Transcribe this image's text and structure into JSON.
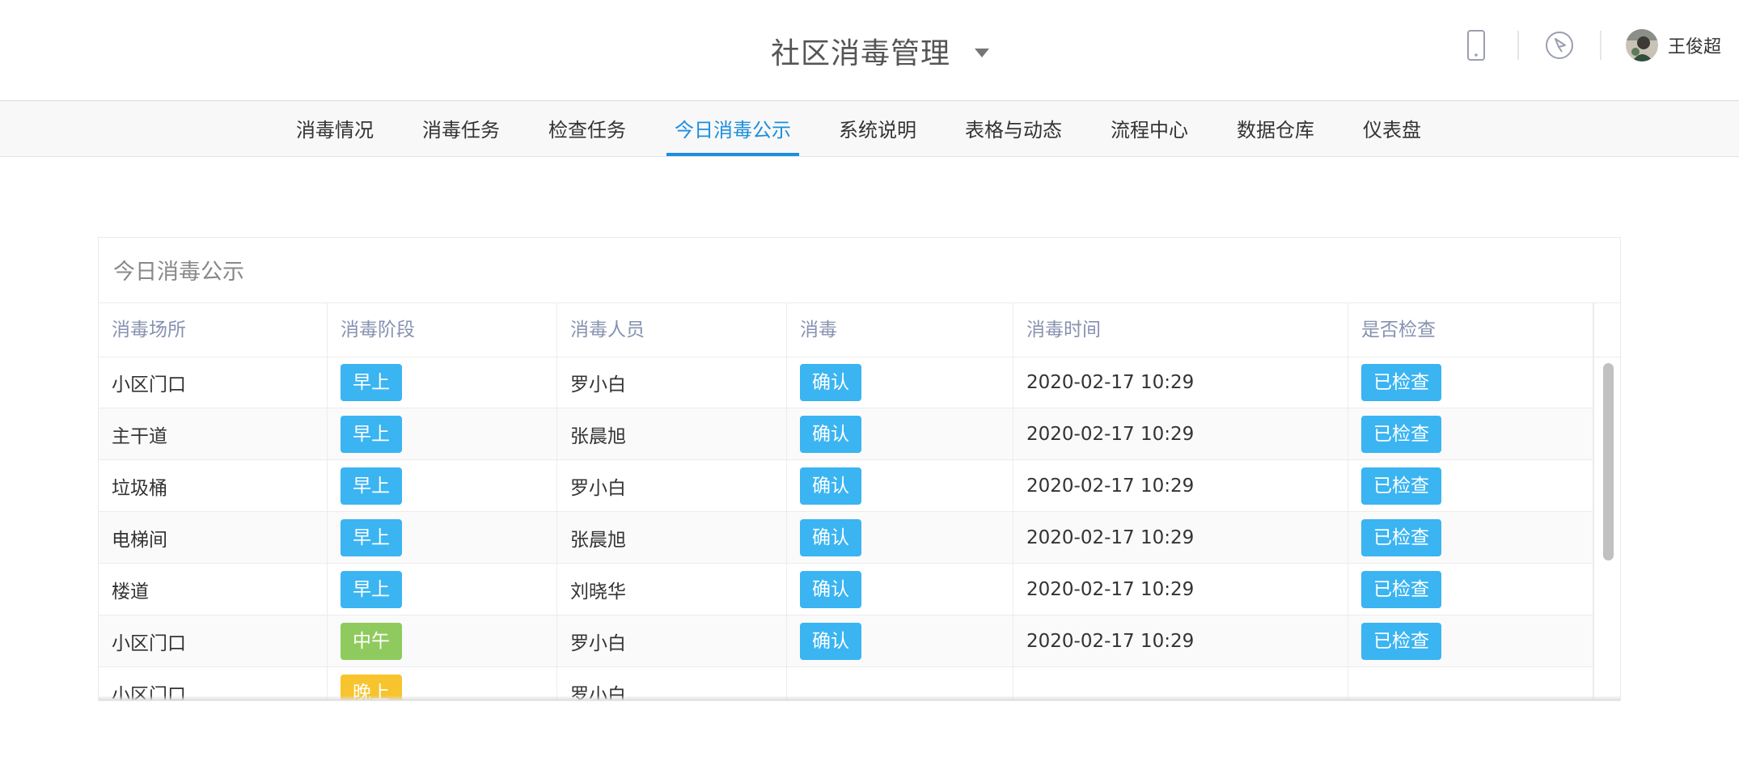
{
  "header": {
    "title": "社区消毒管理",
    "icons": [
      "phone-icon",
      "compass-icon"
    ],
    "user": {
      "name": "王俊超"
    }
  },
  "nav": {
    "active": "今日消毒公示",
    "tabs": [
      "消毒情况",
      "消毒任务",
      "检查任务",
      "今日消毒公示",
      "系统说明",
      "表格与动态",
      "流程中心",
      "数据仓库",
      "仪表盘"
    ]
  },
  "panel": {
    "title": "今日消毒公示",
    "columns": [
      "消毒场所",
      "消毒阶段",
      "消毒人员",
      "消毒",
      "消毒时间",
      "是否检查"
    ],
    "rows": [
      {
        "place": "小区门口",
        "stage": "早上",
        "stage_color": "#3bb4f2",
        "person": "罗小白",
        "action": "确认",
        "time": "2020-02-17 10:29",
        "check": "已检查"
      },
      {
        "place": "主干道",
        "stage": "早上",
        "stage_color": "#3bb4f2",
        "person": "张晨旭",
        "action": "确认",
        "time": "2020-02-17 10:29",
        "check": "已检查"
      },
      {
        "place": "垃圾桶",
        "stage": "早上",
        "stage_color": "#3bb4f2",
        "person": "罗小白",
        "action": "确认",
        "time": "2020-02-17 10:29",
        "check": "已检查"
      },
      {
        "place": "电梯间",
        "stage": "早上",
        "stage_color": "#3bb4f2",
        "person": "张晨旭",
        "action": "确认",
        "time": "2020-02-17 10:29",
        "check": "已检查"
      },
      {
        "place": "楼道",
        "stage": "早上",
        "stage_color": "#3bb4f2",
        "person": "刘晓华",
        "action": "确认",
        "time": "2020-02-17 10:29",
        "check": "已检查"
      },
      {
        "place": "小区门口",
        "stage": "中午",
        "stage_color": "#8fca5e",
        "person": "罗小白",
        "action": "确认",
        "time": "2020-02-17 10:29",
        "check": "已检查"
      },
      {
        "place": "小区门口",
        "stage": "晚上",
        "stage_color": "#f8c42d",
        "person": "罗小白",
        "action": "",
        "time": "",
        "check": ""
      }
    ],
    "accent_color": "#1a8fde"
  }
}
